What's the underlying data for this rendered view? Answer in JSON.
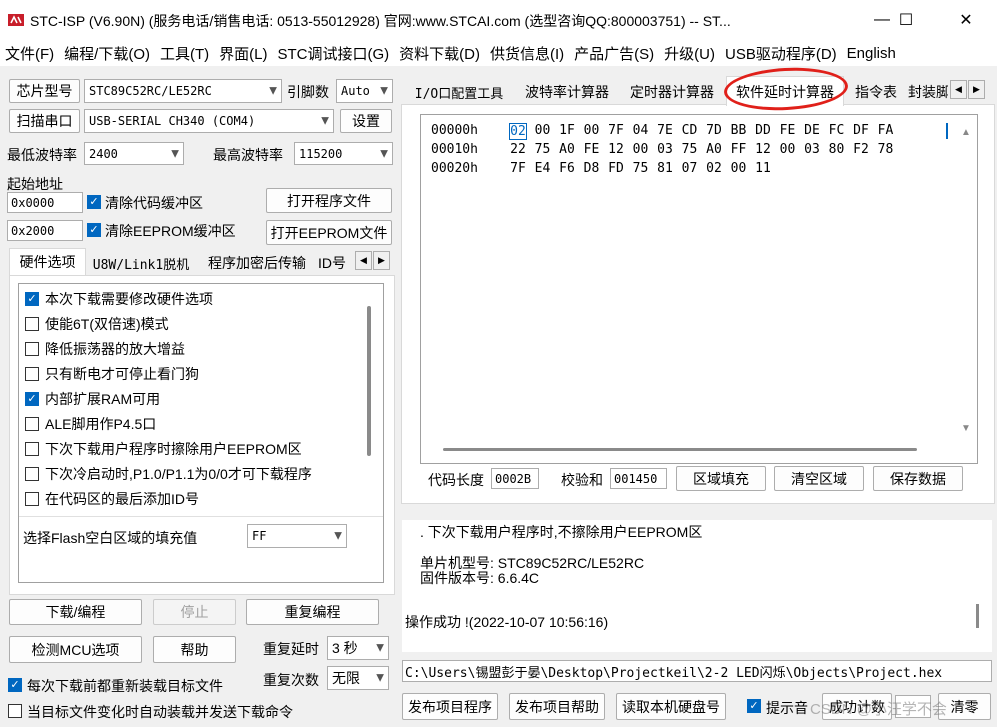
{
  "window": {
    "title": "STC-ISP (V6.90N) (服务电话/销售电话: 0513-55012928) 官网:www.STCAI.com  (选型咨询QQ:800003751) -- ST...",
    "minimize_glyph": "—",
    "maximize_glyph": "☐",
    "close_glyph": "✕"
  },
  "menu": [
    {
      "label": "文件(F)"
    },
    {
      "label": "编程/下载(O)"
    },
    {
      "label": "工具(T)"
    },
    {
      "label": "界面(L)"
    },
    {
      "label": "STC调试接口(G)"
    },
    {
      "label": "资料下载(D)"
    },
    {
      "label": "供货信息(I)"
    },
    {
      "label": "产品广告(S)"
    },
    {
      "label": "升级(U)"
    },
    {
      "label": "USB驱动程序(D)"
    },
    {
      "label": "English"
    }
  ],
  "left": {
    "chip_type_button": "芯片型号",
    "chip_type_value": "STC89C52RC/LE52RC",
    "pin_count_label": "引脚数",
    "pin_count_value": "Auto",
    "scan_port_button": "扫描串口",
    "port_value": "USB-SERIAL CH340 (COM4)",
    "settings_button": "设置",
    "min_baud_label": "最低波特率",
    "min_baud_value": "2400",
    "max_baud_label": "最高波特率",
    "max_baud_value": "115200",
    "start_addr_label": "起始地址",
    "code_addr_value": "0x0000",
    "clear_code_label": "清除代码缓冲区",
    "open_program_button": "打开程序文件",
    "eeprom_addr_value": "0x2000",
    "clear_eeprom_label": "清除EEPROM缓冲区",
    "open_eeprom_button": "打开EEPROM文件",
    "tabs": [
      {
        "label": "硬件选项"
      },
      {
        "label": "U8W/Link1脱机"
      },
      {
        "label": "程序加密后传输"
      },
      {
        "label": "ID号"
      }
    ],
    "options": [
      {
        "label": "本次下载需要修改硬件选项",
        "checked": true
      },
      {
        "label": "使能6T(双倍速)模式",
        "checked": false
      },
      {
        "label": "降低振荡器的放大增益",
        "checked": false
      },
      {
        "label": "只有断电才可停止看门狗",
        "checked": false
      },
      {
        "label": "内部扩展RAM可用",
        "checked": true
      },
      {
        "label": "ALE脚用作P4.5口",
        "checked": false
      },
      {
        "label": "下次下载用户程序时擦除用户EEPROM区",
        "checked": false
      },
      {
        "label": "下次冷启动时,P1.0/P1.1为0/0才可下载程序",
        "checked": false
      },
      {
        "label": "在代码区的最后添加ID号",
        "checked": false
      }
    ],
    "flash_fill_label": "选择Flash空白区域的填充值",
    "flash_fill_value": "FF",
    "download_button": "下载/编程",
    "stop_button": "停止",
    "reprogram_button": "重复编程",
    "detect_mcu_button": "检测MCU选项",
    "help_button": "帮助",
    "repeat_delay_label": "重复延时",
    "repeat_delay_value": "3 秒",
    "repeat_count_label": "重复次数",
    "repeat_count_value": "无限",
    "reload_before_label": "每次下载前都重新装载目标文件",
    "reload_before_checked": true,
    "auto_send_label": "当目标文件变化时自动装载并发送下载命令",
    "auto_send_checked": false
  },
  "right": {
    "tabs": [
      {
        "label": "I/O口配置工具"
      },
      {
        "label": "波特率计算器"
      },
      {
        "label": "定时器计算器"
      },
      {
        "label": "软件延时计算器"
      },
      {
        "label": "指令表"
      },
      {
        "label": "封装脚"
      }
    ],
    "highlight_color": "#e0201a",
    "hex_rows": [
      {
        "addr": "00000h",
        "bytes": [
          "02",
          "00",
          "1F",
          "00",
          "7F",
          "04",
          "7E",
          "CD",
          "7D",
          "BB",
          "DD",
          "FE",
          "DE",
          "FC",
          "DF",
          "FA"
        ]
      },
      {
        "addr": "00010h",
        "bytes": [
          "22",
          "75",
          "A0",
          "FE",
          "12",
          "00",
          "03",
          "75",
          "A0",
          "FF",
          "12",
          "00",
          "03",
          "80",
          "F2",
          "78"
        ]
      },
      {
        "addr": "00020h",
        "bytes": [
          "7F",
          "E4",
          "F6",
          "D8",
          "FD",
          "75",
          "81",
          "07",
          "02",
          "00",
          "11"
        ]
      }
    ],
    "code_length_label": "代码长度",
    "code_length_value": "0002B",
    "checksum_label": "校验和",
    "checksum_value": "001450",
    "fill_area_button": "区域填充",
    "clear_area_button": "清空区域",
    "save_data_button": "保存数据",
    "info_lines": [
      ". 下次下载用户程序时,不擦除用户EEPROM区",
      "单片机型号:  STC89C52RC/LE52RC",
      "固件版本号:  6.6.4C",
      "操作成功 !(2022-10-07 10:56:16)"
    ],
    "file_path": "C:\\Users\\锡盟彭于晏\\Desktop\\Projectkeil\\2-2 LED闪烁\\Objects\\Project.hex",
    "publish_program_button": "发布项目程序",
    "publish_help_button": "发布项目帮助",
    "read_disk_button": "读取本机硬盘号",
    "hint_sound_label": "提示音",
    "hint_sound_checked": true,
    "success_count_label": "成功计数",
    "clear_button": "清零",
    "watermark": "CSDN @小汪学不会"
  }
}
